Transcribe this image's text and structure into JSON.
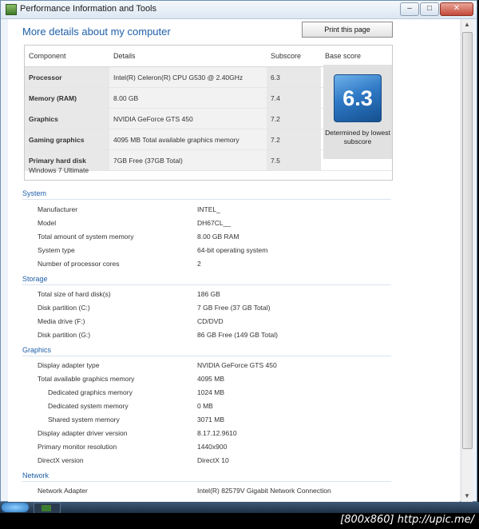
{
  "window": {
    "title": "Performance Information and Tools",
    "minimize": "–",
    "maximize": "□",
    "close": "✕"
  },
  "header": {
    "heading": "More details about my computer",
    "print_label": "Print this page"
  },
  "score_table": {
    "headers": [
      "Component",
      "Details",
      "Subscore",
      "Base score"
    ],
    "rows": [
      {
        "component": "Processor",
        "details": "Intel(R) Celeron(R) CPU G530 @ 2.40GHz",
        "subscore": "6.3"
      },
      {
        "component": "Memory (RAM)",
        "details": "8.00 GB",
        "subscore": "7.4"
      },
      {
        "component": "Graphics",
        "details": "NVIDIA GeForce GTS 450",
        "subscore": "7.2"
      },
      {
        "component": "Gaming graphics",
        "details": "4095 MB Total available graphics memory",
        "subscore": "7.2"
      },
      {
        "component": "Primary hard disk",
        "details": "7GB Free (37GB Total)",
        "subscore": "7.5"
      }
    ],
    "base_score": "6.3",
    "base_note": "Determined by lowest subscore",
    "os": "Windows 7 Ultimate"
  },
  "sections": {
    "system": {
      "title": "System",
      "rows": [
        {
          "label": "Manufacturer",
          "value": "INTEL_"
        },
        {
          "label": "Model",
          "value": "DH67CL__"
        },
        {
          "label": "Total amount of system memory",
          "value": "8.00 GB RAM"
        },
        {
          "label": "System type",
          "value": "64-bit operating system"
        },
        {
          "label": "Number of processor cores",
          "value": "2"
        }
      ]
    },
    "storage": {
      "title": "Storage",
      "rows": [
        {
          "label": "Total size of hard disk(s)",
          "value": "186 GB"
        },
        {
          "label": "Disk partition (C:)",
          "value": "7 GB Free (37 GB Total)"
        },
        {
          "label": "Media drive (F:)",
          "value": "CD/DVD"
        },
        {
          "label": "Disk partition (G:)",
          "value": "86 GB Free (149 GB Total)"
        }
      ]
    },
    "graphics": {
      "title": "Graphics",
      "rows": [
        {
          "label": "Display adapter type",
          "value": "NVIDIA GeForce GTS 450"
        },
        {
          "label": "Total available graphics memory",
          "value": "4095 MB"
        },
        {
          "label": "Dedicated graphics memory",
          "value": "1024 MB"
        },
        {
          "label": "Dedicated system memory",
          "value": "0 MB"
        },
        {
          "label": "Shared system memory",
          "value": "3071 MB"
        },
        {
          "label": "Display adapter driver version",
          "value": "8.17.12.9610"
        },
        {
          "label": "Primary monitor resolution",
          "value": "1440x900"
        },
        {
          "label": "DirectX version",
          "value": "DirectX 10"
        }
      ]
    },
    "network": {
      "title": "Network",
      "rows": [
        {
          "label": "Network Adapter",
          "value": "Intel(R) 82579V Gigabit Network Connection"
        }
      ]
    }
  },
  "footer": {
    "credit": "[800x860] http://upic.me/"
  }
}
